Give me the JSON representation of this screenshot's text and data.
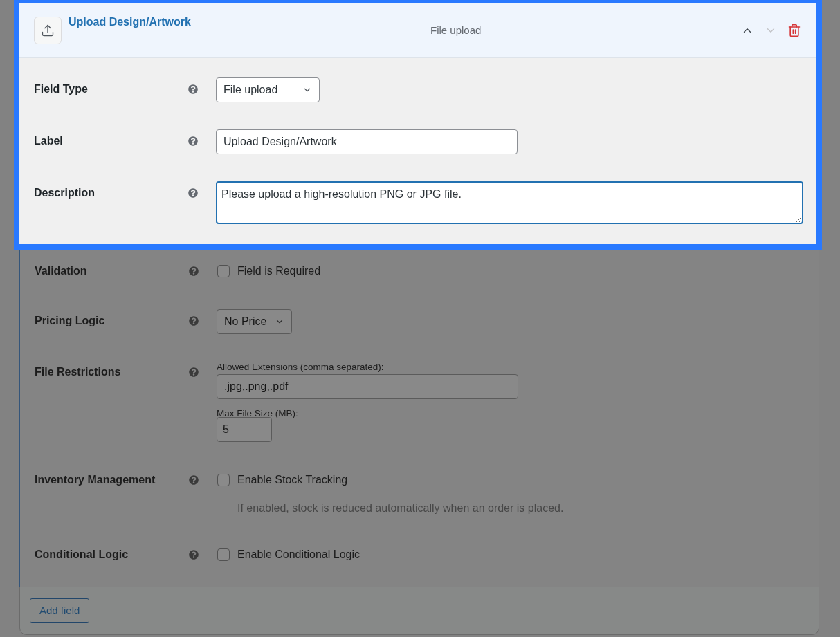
{
  "card": {
    "header": {
      "title": "Upload Design/Artwork",
      "type_label": "File upload",
      "highlighted": true,
      "actions": [
        {
          "kind": "move-up",
          "disabled": false
        },
        {
          "kind": "move-down",
          "disabled": true
        },
        {
          "kind": "delete",
          "disabled": false
        }
      ]
    },
    "rows": [
      {
        "kind": "select",
        "label": "Field Type",
        "value": "File upload",
        "highlighted": true
      },
      {
        "kind": "text",
        "label": "Label",
        "value": "Upload Design/Artwork",
        "highlighted": true
      },
      {
        "kind": "textarea",
        "label": "Description",
        "value": "Please upload a high-resolution PNG or JPG file.",
        "focused": true,
        "highlighted": true
      },
      {
        "kind": "checkbox",
        "label": "Validation",
        "option": "Field is Required",
        "checked": false,
        "highlighted": false
      },
      {
        "kind": "select",
        "label": "Pricing Logic",
        "value": "No Price",
        "highlighted": false
      },
      {
        "kind": "inputs",
        "label": "File Restrictions",
        "inputs": [
          {
            "kind": "text",
            "caption": "Allowed Extensions (comma separated):",
            "value": ".jpg,.png,.pdf"
          },
          {
            "kind": "number",
            "caption": "Max File Size (MB):",
            "value": "5"
          }
        ],
        "highlighted": false
      },
      {
        "kind": "checkbox",
        "label": "Inventory Management",
        "option": "Enable Stock Tracking",
        "checked": false,
        "note": "If enabled, stock is reduced automatically when an order is placed.",
        "highlighted": false
      },
      {
        "kind": "checkbox",
        "label": "Conditional Logic",
        "option": "Enable Conditional Logic",
        "checked": false,
        "highlighted": false
      }
    ],
    "footer": {
      "button": "Add field"
    }
  }
}
